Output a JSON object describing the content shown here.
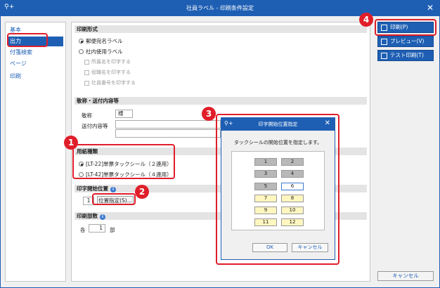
{
  "window": {
    "title": "社員ラベル - 印刷条件設定",
    "app_icon": "⚲+",
    "close": "✕"
  },
  "sidebar": {
    "items": [
      {
        "label": "基本"
      },
      {
        "label": "出力"
      },
      {
        "label": "付箋検索"
      },
      {
        "label": "ページ"
      },
      {
        "label": "印刷"
      }
    ]
  },
  "print_format": {
    "heading": "印刷形式",
    "options": [
      "郵便宛名ラベル",
      "社内使用ラベル"
    ],
    "checkboxes": [
      "所属名を印字する",
      "役職名を印字する",
      "社員番号を印字する"
    ]
  },
  "honorific": {
    "heading": "敬称・送付内容等",
    "honorific_label": "敬称",
    "honorific_value": "様",
    "send_label": "送付内容等"
  },
  "paper": {
    "heading": "用紙種類",
    "options": [
      "[LT-22]単票タックシール（２連用）",
      "[LT-42]単票タックシール（４連用）"
    ]
  },
  "start_position": {
    "heading": "印字開始位置",
    "value": "1",
    "button": "位置指定(S)..."
  },
  "copies": {
    "heading": "印刷部数",
    "prefix": "各",
    "value": "1",
    "suffix": "部"
  },
  "right_buttons": {
    "print": "印刷(P)",
    "preview": "プレビュー(V)",
    "test": "テスト印刷(T)",
    "cancel": "キャンセル"
  },
  "dialog": {
    "title": "印字開始位置指定",
    "app_icon": "⚲+",
    "close": "✕",
    "message": "タックシールの開始位置を指定します。",
    "cells": [
      "1",
      "2",
      "3",
      "4",
      "5",
      "6",
      "7",
      "8",
      "9",
      "10",
      "11",
      "12"
    ],
    "ok": "OK",
    "cancel": "キャンセル"
  },
  "badges": [
    "1",
    "2",
    "3",
    "4"
  ],
  "colors": {
    "accent": "#1e5fb4",
    "highlight": "#e01e2a",
    "cell_yellow": "#fff6c0",
    "cell_gray": "#b8b8b8"
  }
}
